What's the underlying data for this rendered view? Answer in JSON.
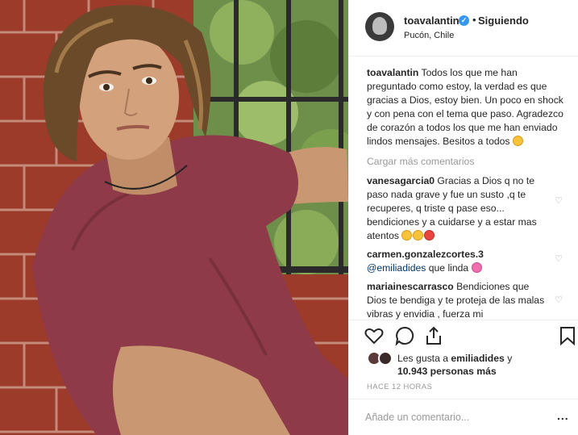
{
  "header": {
    "username": "toavalantin",
    "separator": "•",
    "follow_status": "Siguiendo",
    "location": "Pucón, Chile"
  },
  "caption": {
    "username": "toavalantin",
    "text": "Todos los que me han preguntado como estoy, la verdad es que gracias a Dios, estoy bien. Un poco en shock y con pena con el tema que paso. Agradezco de corazón a todos los que me han enviado lindos mensajes. Besitos a todos"
  },
  "load_more": "Cargar más comentarios",
  "comments": [
    {
      "username": "vanesagarcia0",
      "text": "Gracias a Dios q no te paso nada grave y fue un susto ,q te recuperes, q triste q pase eso... bendiciones y a cuidarse y a estar mas atentos"
    },
    {
      "username": "carmen.gonzalezcortes.3",
      "mention": "@emiliadides",
      "text": "que linda"
    },
    {
      "username": "mariainescarrasco",
      "text": "Bendiciones que Dios te bendiga y te proteja de las malas vibras y envidia , fuerza mi"
    }
  ],
  "likes": {
    "prefix": "Les gusta a",
    "liked_by": "emiliadides",
    "joiner": "y",
    "count": "10.943 personas más"
  },
  "timestamp": "HACE 12 HORAS",
  "add_comment": {
    "placeholder": "Añade un comentario..."
  },
  "more_options": "...",
  "icons": {
    "like": "heart-icon",
    "comment": "comment-icon",
    "share": "share-icon",
    "save": "bookmark-icon",
    "verified": "verified-badge-icon",
    "more": "more-options-icon"
  },
  "colors": {
    "verified": "#3897f0",
    "mention": "#003569",
    "muted": "#999999",
    "text": "#262626"
  }
}
